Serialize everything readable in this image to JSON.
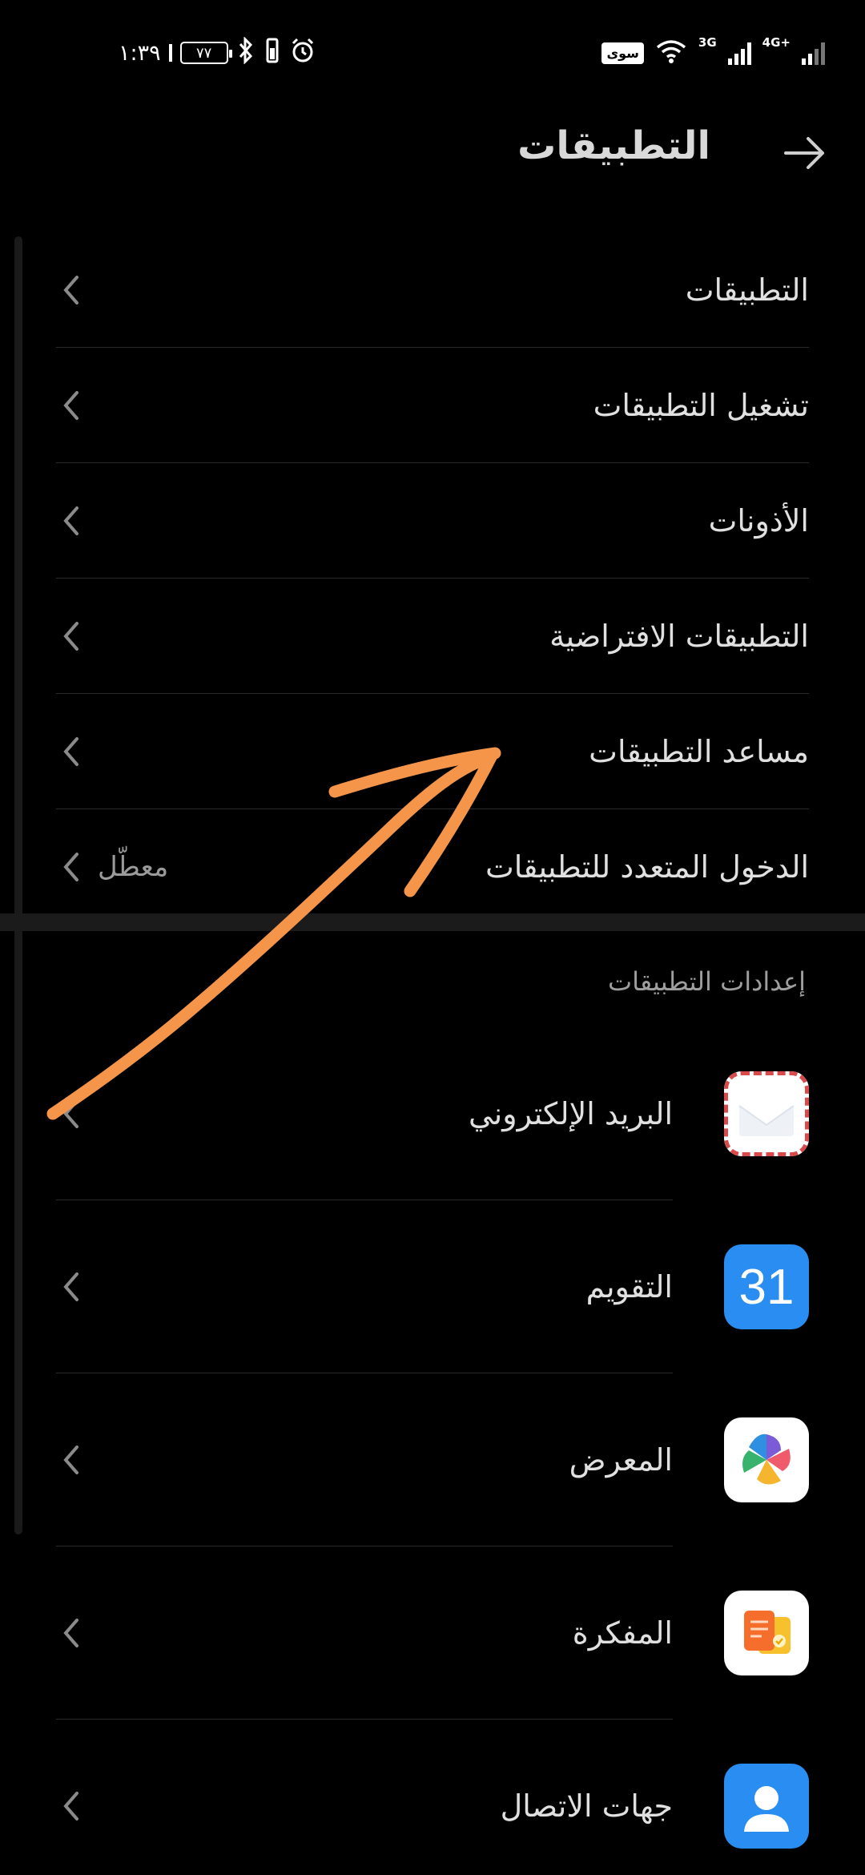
{
  "status_bar": {
    "time": "١:٣٩",
    "battery_level": "٧٧",
    "carrier_badge": "سوى",
    "network_a": "3G",
    "network_b": "4G+",
    "icons": [
      "sim-icon",
      "battery-icon",
      "bluetooth-icon",
      "vibrate-icon",
      "alarm-icon",
      "wifi-icon",
      "signal-icon"
    ]
  },
  "header": {
    "title": "التطبيقات",
    "back_icon": "arrow-right-icon"
  },
  "menu": {
    "items": [
      {
        "label": "التطبيقات"
      },
      {
        "label": "تشغيل التطبيقات"
      },
      {
        "label": "الأذونات"
      },
      {
        "label": "التطبيقات الافتراضية"
      },
      {
        "label": "مساعد التطبيقات"
      },
      {
        "label": "الدخول المتعدد للتطبيقات",
        "value": "معطّل"
      }
    ]
  },
  "app_settings": {
    "section_title": "إعدادات التطبيقات",
    "apps": [
      {
        "label": "البريد الإلكتروني",
        "icon": "email-icon"
      },
      {
        "label": "التقويم",
        "icon": "calendar-icon",
        "icon_text": "31"
      },
      {
        "label": "المعرض",
        "icon": "gallery-icon"
      },
      {
        "label": "المفكرة",
        "icon": "notepad-icon"
      },
      {
        "label": "جهات الاتصال",
        "icon": "contacts-icon"
      }
    ]
  },
  "colors": {
    "background": "#000000",
    "text": "#e0e0e0",
    "secondary_text": "#9e9e9e",
    "accent_blue": "#2a8df2",
    "annotation_orange": "#f5954a"
  }
}
